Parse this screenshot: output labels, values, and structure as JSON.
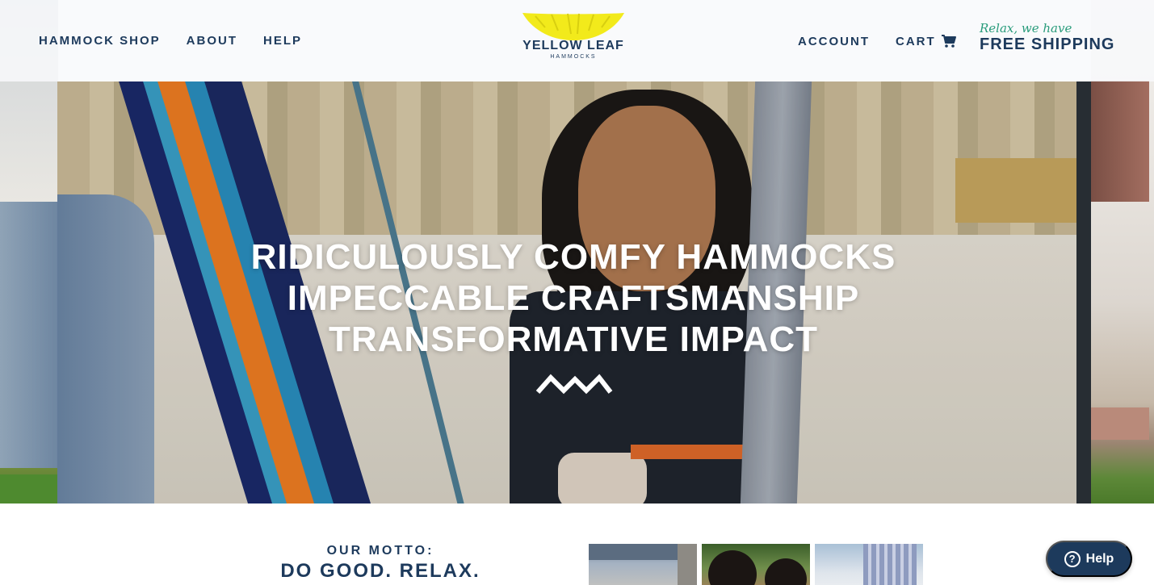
{
  "header": {
    "nav_left": [
      "HAMMOCK SHOP",
      "ABOUT",
      "HELP"
    ],
    "logo_text": "YELLOW LEAF",
    "logo_sub": "HAMMOCKS",
    "account_label": "ACCOUNT",
    "cart_label": "CART",
    "shipping_script": "Relax, we have",
    "shipping_main": "FREE SHIPPING"
  },
  "hero": {
    "headline_lines": [
      "RIDICULOUSLY COMFY HAMMOCKS",
      "IMPECCABLE CRAFTSMANSHIP",
      "TRANSFORMATIVE IMPACT"
    ]
  },
  "motto": {
    "label": "OUR MOTTO:",
    "title": "DO GOOD. RELAX."
  },
  "help_button": {
    "label": "Help",
    "icon_glyph": "?"
  },
  "icons": {
    "cart": "cart-icon",
    "logo": "leaf-logo-icon",
    "zigzag": "zigzag-divider-icon",
    "help": "question-circle-icon"
  },
  "colors": {
    "brand_navy": "#1d3a5c",
    "logo_yellow": "#f2ea1b",
    "script_teal": "#2a9c7c"
  }
}
